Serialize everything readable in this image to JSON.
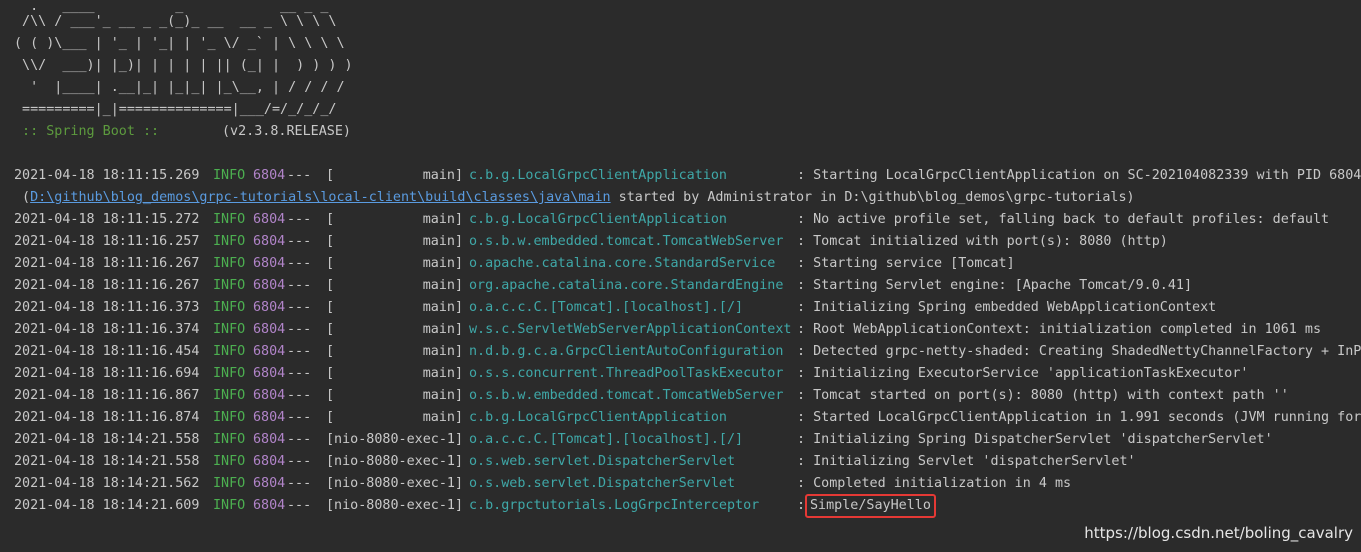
{
  "banner": [
    "  .   ____          _            __ _ _",
    " /\\\\ / ___'_ __ _ _(_)_ __  __ _ \\ \\ \\ \\",
    "( ( )\\___ | '_ | '_| | '_ \\/ _` | \\ \\ \\ \\",
    " \\\\/  ___)| |_)| | | | | || (_| |  ) ) ) )",
    "  '  |____| .__|_| |_|_| |_\\__, | / / / /",
    " =========|_|==============|___/=/_/_/_/"
  ],
  "spring_boot": {
    "label": " :: Spring Boot ::",
    "version": "(v2.3.8.RELEASE)"
  },
  "log_lines": [
    {
      "ts": "2021-04-18 18:11:15.269",
      "level": "INFO",
      "pid": "6804",
      "sep": "---",
      "thread": "[           main]",
      "logger": "c.b.g.LocalGrpcClientApplication",
      "message": ": Starting LocalGrpcClientApplication on SC-202104082339 with PID 6804"
    },
    {
      "continuation": true,
      "open": " (",
      "link": "D:\\github\\blog_demos\\grpc-tutorials\\local-client\\build\\classes\\java\\main",
      "rest": " started by Administrator in D:\\github\\blog_demos\\grpc-tutorials)"
    },
    {
      "ts": "2021-04-18 18:11:15.272",
      "level": "INFO",
      "pid": "6804",
      "sep": "---",
      "thread": "[           main]",
      "logger": "c.b.g.LocalGrpcClientApplication",
      "message": ": No active profile set, falling back to default profiles: default"
    },
    {
      "ts": "2021-04-18 18:11:16.257",
      "level": "INFO",
      "pid": "6804",
      "sep": "---",
      "thread": "[           main]",
      "logger": "o.s.b.w.embedded.tomcat.TomcatWebServer",
      "message": ": Tomcat initialized with port(s): 8080 (http)"
    },
    {
      "ts": "2021-04-18 18:11:16.267",
      "level": "INFO",
      "pid": "6804",
      "sep": "---",
      "thread": "[           main]",
      "logger": "o.apache.catalina.core.StandardService",
      "message": ": Starting service [Tomcat]"
    },
    {
      "ts": "2021-04-18 18:11:16.267",
      "level": "INFO",
      "pid": "6804",
      "sep": "---",
      "thread": "[           main]",
      "logger": "org.apache.catalina.core.StandardEngine",
      "message": ": Starting Servlet engine: [Apache Tomcat/9.0.41]"
    },
    {
      "ts": "2021-04-18 18:11:16.373",
      "level": "INFO",
      "pid": "6804",
      "sep": "---",
      "thread": "[           main]",
      "logger": "o.a.c.c.C.[Tomcat].[localhost].[/]",
      "message": ": Initializing Spring embedded WebApplicationContext"
    },
    {
      "ts": "2021-04-18 18:11:16.374",
      "level": "INFO",
      "pid": "6804",
      "sep": "---",
      "thread": "[           main]",
      "logger": "w.s.c.ServletWebServerApplicationContext",
      "message": ": Root WebApplicationContext: initialization completed in 1061 ms"
    },
    {
      "ts": "2021-04-18 18:11:16.454",
      "level": "INFO",
      "pid": "6804",
      "sep": "---",
      "thread": "[           main]",
      "logger": "n.d.b.g.c.a.GrpcClientAutoConfiguration",
      "message": ": Detected grpc-netty-shaded: Creating ShadedNettyChannelFactory + InPr"
    },
    {
      "ts": "2021-04-18 18:11:16.694",
      "level": "INFO",
      "pid": "6804",
      "sep": "---",
      "thread": "[           main]",
      "logger": "o.s.s.concurrent.ThreadPoolTaskExecutor",
      "message": ": Initializing ExecutorService 'applicationTaskExecutor'"
    },
    {
      "ts": "2021-04-18 18:11:16.867",
      "level": "INFO",
      "pid": "6804",
      "sep": "---",
      "thread": "[           main]",
      "logger": "o.s.b.w.embedded.tomcat.TomcatWebServer",
      "message": ": Tomcat started on port(s): 8080 (http) with context path ''"
    },
    {
      "ts": "2021-04-18 18:11:16.874",
      "level": "INFO",
      "pid": "6804",
      "sep": "---",
      "thread": "[           main]",
      "logger": "c.b.g.LocalGrpcClientApplication",
      "message": ": Started LocalGrpcClientApplication in 1.991 seconds (JVM running for"
    },
    {
      "ts": "2021-04-18 18:14:21.558",
      "level": "INFO",
      "pid": "6804",
      "sep": "---",
      "thread": "[nio-8080-exec-1]",
      "logger": "o.a.c.c.C.[Tomcat].[localhost].[/]",
      "message": ": Initializing Spring DispatcherServlet 'dispatcherServlet'"
    },
    {
      "ts": "2021-04-18 18:14:21.558",
      "level": "INFO",
      "pid": "6804",
      "sep": "---",
      "thread": "[nio-8080-exec-1]",
      "logger": "o.s.web.servlet.DispatcherServlet",
      "message": ": Initializing Servlet 'dispatcherServlet'"
    },
    {
      "ts": "2021-04-18 18:14:21.562",
      "level": "INFO",
      "pid": "6804",
      "sep": "---",
      "thread": "[nio-8080-exec-1]",
      "logger": "o.s.web.servlet.DispatcherServlet",
      "message": ": Completed initialization in 4 ms"
    },
    {
      "ts": "2021-04-18 18:14:21.609",
      "level": "INFO",
      "pid": "6804",
      "sep": "---",
      "thread": "[nio-8080-exec-1]",
      "logger": "c.b.grpctutorials.LogGrpcInterceptor",
      "message_prefix": ":",
      "message": "Simple/SayHello",
      "highlighted": true
    }
  ],
  "watermark": "https://blog.csdn.net/boling_cavalry",
  "colors": {
    "background": "#2b2b2b",
    "text": "#c8c8c8",
    "info": "#4caf50",
    "pid": "#b184c9",
    "logger": "#3fa8a8",
    "spring": "#5d9b3e",
    "link": "#5a9be0",
    "highlight_border": "#e53935"
  }
}
